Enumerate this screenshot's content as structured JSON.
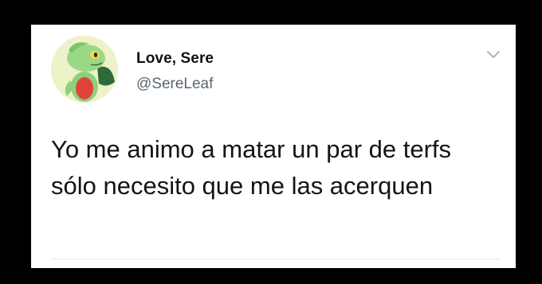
{
  "tweet": {
    "display_name": "Love, Sere",
    "handle": "@SereLeaf",
    "text": "Yo me animo a matar un par de terfs sólo necesito que me las acerquen",
    "avatar_icon": "treecko-avatar",
    "menu_icon": "chevron-down-icon"
  },
  "colors": {
    "background": "#000000",
    "card": "#ffffff",
    "name": "#111111",
    "handle": "#5b6670",
    "text": "#141414"
  }
}
